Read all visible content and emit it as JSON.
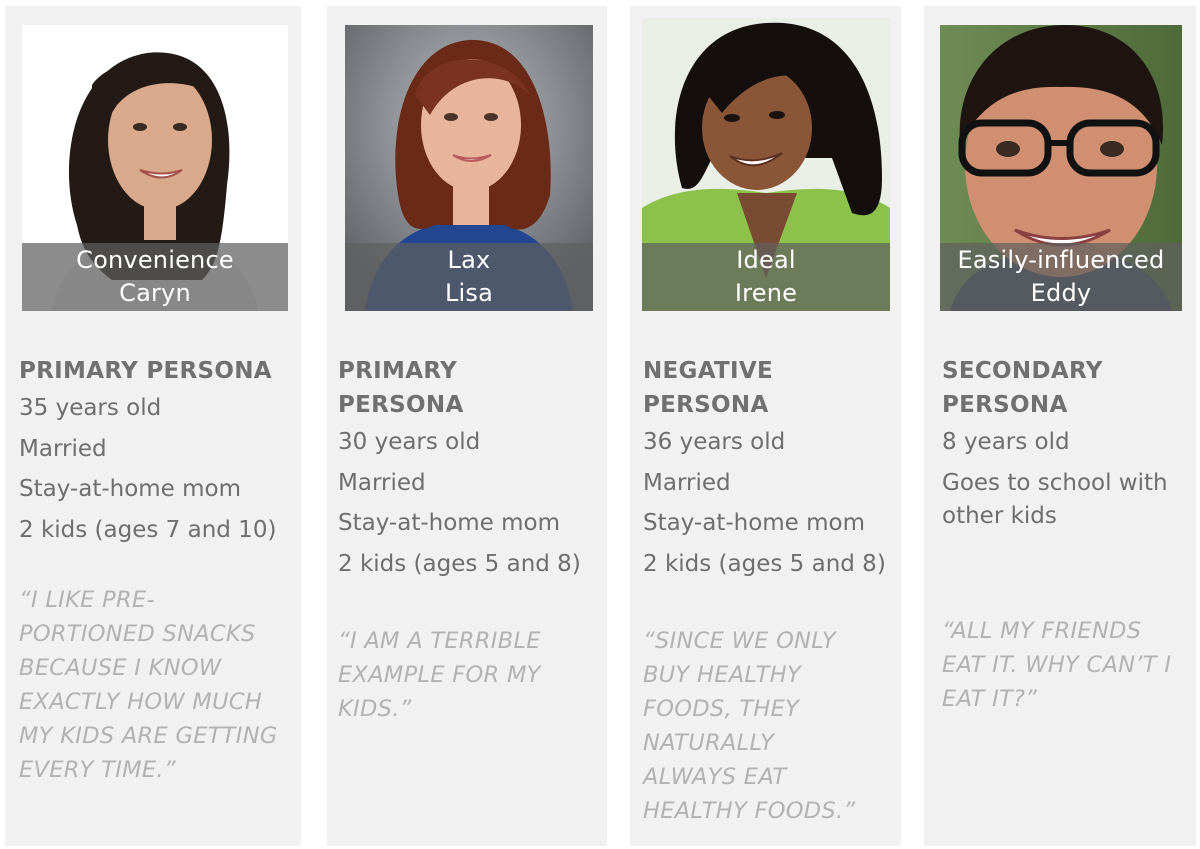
{
  "personas": [
    {
      "name_line1": "Convenience",
      "name_line2": "Caryn",
      "role": "PRIMARY PERSONA",
      "facts": [
        "35 years old",
        "Married",
        "Stay-at-home mom",
        "2 kids (ages 7 and 10)"
      ],
      "quote": "“I like pre-portioned snacks because I know exactly how much my kids are getting every time.”",
      "colors": {
        "background": "#ffffff",
        "hair": "#231915",
        "skin": "#d9a98b",
        "shirt": "#ececec"
      }
    },
    {
      "name_line1": "Lax",
      "name_line2": "Lisa",
      "role": "PRIMARY PERSONA",
      "facts": [
        "30 years old",
        "Married",
        "Stay-at-home mom",
        "2 kids (ages 5 and 8)"
      ],
      "quote": "“I am a terrible example for my kids.”",
      "colors": {
        "background": "#7d8186",
        "hair": "#6b2a18",
        "skin": "#e8b49c",
        "shirt": "#22468f"
      }
    },
    {
      "name_line1": "Ideal",
      "name_line2": "Irene",
      "role": "NEGATIVE PERSONA",
      "facts": [
        "36 years old",
        "Married",
        "Stay-at-home mom",
        "2 kids (ages 5 and 8)"
      ],
      "quote": "“Since we only buy healthy foods, they naturally always eat healthy foods.”",
      "colors": {
        "background": "#e9eee7",
        "hair": "#140f0d",
        "skin": "#8b5638",
        "shirt": "#8cc14b"
      }
    },
    {
      "name_line1": "Easily-influenced",
      "name_line2": "Eddy",
      "role": "SECONDARY PERSONA",
      "facts": [
        "8 years old",
        "Goes to school with other kids"
      ],
      "quote": "“All my friends eat it. Why can’t I eat it?”",
      "colors": {
        "background": "#5c7a45",
        "hair": "#1e1511",
        "skin": "#cf8f70",
        "shirt": "#3a4b63"
      }
    }
  ]
}
